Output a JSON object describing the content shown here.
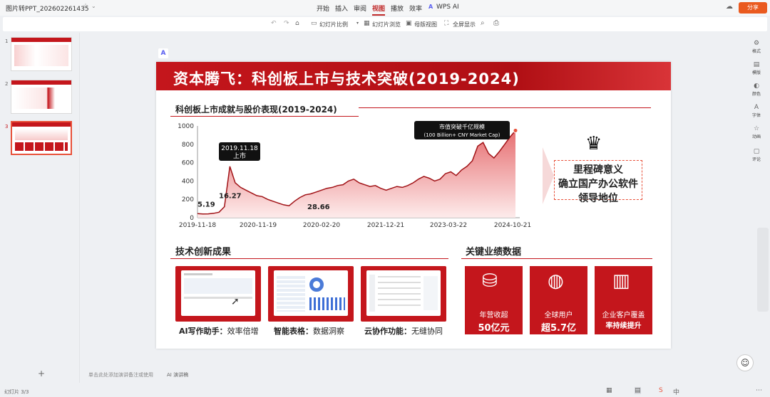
{
  "app": {
    "filename": "图片转PPT_202602261435",
    "tabs": [
      "开始",
      "插入",
      "审阅",
      "视图",
      "播放",
      "效率",
      "WPS AI"
    ],
    "active_tab": "视图",
    "share": "分享"
  },
  "toolbar": {
    "ratio": "幻灯片比例",
    "browse": "幻灯片浏览",
    "notes": "母版视图",
    "fullscreen": "全屏显示"
  },
  "thumbs": [
    "1",
    "2",
    "3"
  ],
  "rightbar": [
    "格式",
    "模版",
    "颜色",
    "字体",
    "动画",
    "评论"
  ],
  "slide": {
    "title": "资本腾飞：科创板上市与技术突破(2019-2024)",
    "chart_section": "科创板上市成就与股价表现(2019-2024)",
    "milestone": {
      "line1": "里程碑意义",
      "line2": "确立国产办公软件",
      "line3": "领导地位"
    },
    "tech_section": "技术创新成果",
    "tech": [
      {
        "bold": "AI写作助手：",
        "rest": "效率倍增"
      },
      {
        "bold": "智能表格：",
        "rest": "数据洞察"
      },
      {
        "bold": "云协作功能：",
        "rest": "无缝协同"
      }
    ],
    "perf_section": "关键业绩数据",
    "stats": [
      {
        "l1": "年营收超",
        "l2": "50亿元"
      },
      {
        "l1": "全球用户",
        "l2": "超5.7亿"
      },
      {
        "l1": "企业客户覆盖",
        "l2": "率持续提升"
      }
    ]
  },
  "status": {
    "slide_no": "幻灯片 3/3",
    "notes_hint": "单击此处添加演讲备注或使用",
    "ai_notes": "AI 演讲稿"
  },
  "chart_data": {
    "type": "area",
    "title": "科创板上市成就与股价表现(2019-2024)",
    "x_ticks": [
      "2019-11-18",
      "2020-11-19",
      "2020-02-20",
      "2021-12-21",
      "2023-03-22",
      "2024-10-21"
    ],
    "ylim": [
      0,
      1000
    ],
    "y_ticks": [
      0,
      200,
      400,
      600,
      800,
      1000
    ],
    "labels": [
      "5.19",
      "16.27",
      "28.66"
    ],
    "callouts": [
      {
        "line1": "2019.11.18",
        "line2": "上市"
      },
      {
        "line1": "市值突破千亿规模",
        "line2": "(100 Billion+ CNY Market Cap)"
      }
    ],
    "series": [
      {
        "values": [
          45,
          40,
          42,
          48,
          60,
          120,
          560,
          380,
          330,
          300,
          270,
          240,
          230,
          200,
          180,
          160,
          140,
          130,
          180,
          220,
          250,
          260,
          280,
          300,
          320,
          330,
          350,
          360,
          400,
          420,
          380,
          360,
          340,
          350,
          320,
          300,
          320,
          340,
          330,
          350,
          380,
          420,
          450,
          430,
          400,
          420,
          480,
          500,
          460,
          520,
          560,
          620,
          780,
          820,
          700,
          650,
          720,
          800,
          880,
          950
        ]
      }
    ],
    "colors": {
      "line": "#a01216",
      "fill_top": "#e25558",
      "fill_bottom": "#fde8e8"
    }
  }
}
